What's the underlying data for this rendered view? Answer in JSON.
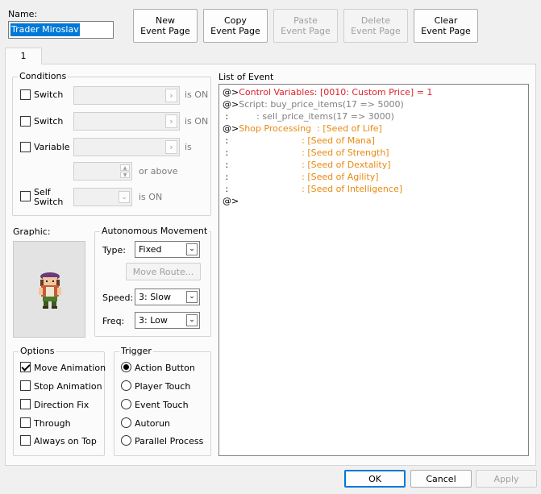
{
  "name_label": "Name:",
  "name_value": "Trader Miroslav",
  "toolbar": {
    "new_label": "New\nEvent Page",
    "copy_label": "Copy\nEvent Page",
    "paste_label": "Paste\nEvent Page",
    "delete_label": "Delete\nEvent Page",
    "clear_label": "Clear\nEvent Page"
  },
  "tab": "1",
  "conditions": {
    "title": "Conditions",
    "switch1": "Switch",
    "switch2": "Switch",
    "variable": "Variable",
    "self_switch_1": "Self",
    "self_switch_2": "Switch",
    "is_on_1": "is ON",
    "is_on_2": "is ON",
    "is": "is",
    "or_above": "or above",
    "is_on_3": "is ON"
  },
  "graphic_label": "Graphic:",
  "movement": {
    "title": "Autonomous Movement",
    "type_label": "Type:",
    "type_value": "Fixed",
    "move_route": "Move Route...",
    "speed_label": "Speed:",
    "speed_value": "3: Slow",
    "freq_label": "Freq:",
    "freq_value": "3: Low"
  },
  "options": {
    "title": "Options",
    "items": [
      {
        "label": "Move Animation",
        "checked": true
      },
      {
        "label": "Stop Animation",
        "checked": false
      },
      {
        "label": "Direction Fix",
        "checked": false
      },
      {
        "label": "Through",
        "checked": false
      },
      {
        "label": "Always on Top",
        "checked": false
      }
    ]
  },
  "trigger": {
    "title": "Trigger",
    "items": [
      {
        "label": "Action Button",
        "selected": true
      },
      {
        "label": "Player Touch",
        "selected": false
      },
      {
        "label": "Event Touch",
        "selected": false
      },
      {
        "label": "Autorun",
        "selected": false
      },
      {
        "label": "Parallel Process",
        "selected": false
      }
    ]
  },
  "event_list": {
    "title": "List of Event",
    "lines": [
      {
        "prefix": "@>",
        "text": "Control Variables: [0010: Custom Price] = 1",
        "color": "#e0202a"
      },
      {
        "prefix": "@>",
        "text": "Script: buy_price_items(17 => 5000)",
        "color": "#808080"
      },
      {
        "prefix": " :",
        "text": "          : sell_price_items(17 => 3000)",
        "color": "#808080"
      },
      {
        "prefix": "@>",
        "text": "Shop Processing  : [Seed of Life]",
        "color": "#e88a10"
      },
      {
        "prefix": " :",
        "text": "                          : [Seed of Mana]",
        "color": "#e88a10"
      },
      {
        "prefix": " :",
        "text": "                          : [Seed of Strength]",
        "color": "#e88a10"
      },
      {
        "prefix": " :",
        "text": "                          : [Seed of Dextality]",
        "color": "#e88a10"
      },
      {
        "prefix": " :",
        "text": "                          : [Seed of Agility]",
        "color": "#e88a10"
      },
      {
        "prefix": " :",
        "text": "                          : [Seed of Intelligence]",
        "color": "#e88a10"
      },
      {
        "prefix": "@>",
        "text": "",
        "color": "#000000"
      }
    ]
  },
  "footer": {
    "ok": "OK",
    "cancel": "Cancel",
    "apply": "Apply"
  }
}
